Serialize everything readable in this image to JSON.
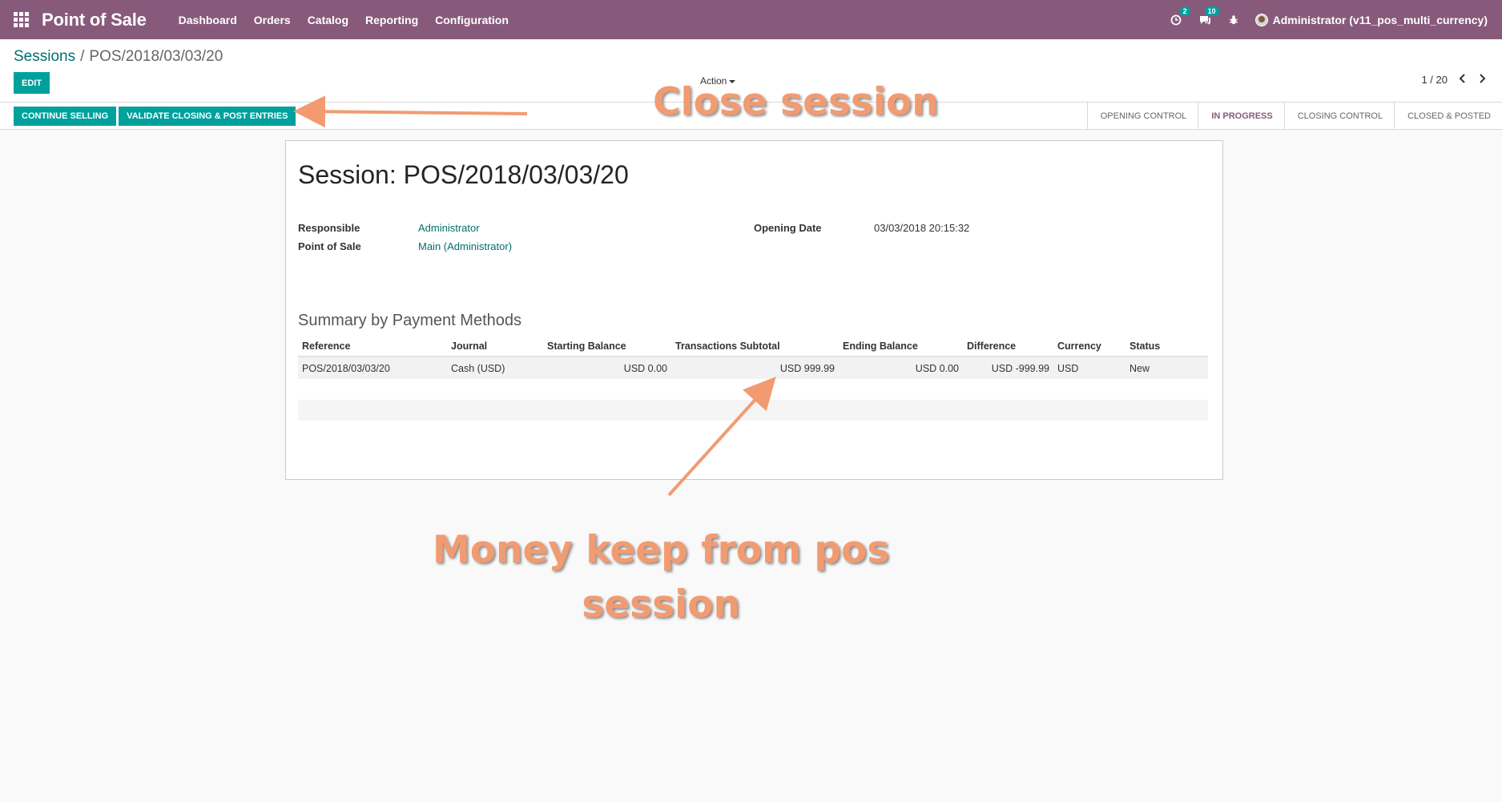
{
  "navbar": {
    "app_title": "Point of Sale",
    "menu": [
      "Dashboard",
      "Orders",
      "Catalog",
      "Reporting",
      "Configuration"
    ],
    "activity_badge": "2",
    "messages_badge": "10",
    "user_name": "Administrator (v11_pos_multi_currency)",
    "icons": [
      "apps-grid-icon",
      "activity-clock-icon",
      "chat-icon",
      "bug-icon",
      "avatar"
    ],
    "brand_color": "#875a7b"
  },
  "breadcrumb": {
    "parent": "Sessions",
    "separator": "/",
    "current": "POS/2018/03/03/20"
  },
  "toolbar": {
    "edit_label": "EDIT",
    "action_label": "Action",
    "pager_value": "1 / 20"
  },
  "statusbar": {
    "buttons": [
      "CONTINUE SELLING",
      "VALIDATE CLOSING & POST ENTRIES"
    ],
    "stages": [
      "OPENING CONTROL",
      "IN PROGRESS",
      "CLOSING CONTROL",
      "CLOSED & POSTED"
    ],
    "active_stage": "IN PROGRESS",
    "accent_color": "#00a09d"
  },
  "session": {
    "title": "Session: POS/2018/03/03/20",
    "responsible_label": "Responsible",
    "responsible_value": "Administrator",
    "pos_label": "Point of Sale",
    "pos_value": "Main (Administrator)",
    "opening_date_label": "Opening Date",
    "opening_date_value": "03/03/2018 20:15:32"
  },
  "payment_summary": {
    "title": "Summary by Payment Methods",
    "columns": [
      "Reference",
      "Journal",
      "Starting Balance",
      "Transactions Subtotal",
      "Ending Balance",
      "Difference",
      "Currency",
      "Status"
    ],
    "rows": [
      [
        "POS/2018/03/03/20",
        "Cash (USD)",
        "USD 0.00",
        "USD 999.99",
        "USD 0.00",
        "USD -999.99",
        "USD",
        "New"
      ]
    ]
  },
  "annotations": {
    "close_session": "Close session",
    "money_line1": "Money keep from pos",
    "money_line2": "session",
    "color": "#f29b71"
  }
}
